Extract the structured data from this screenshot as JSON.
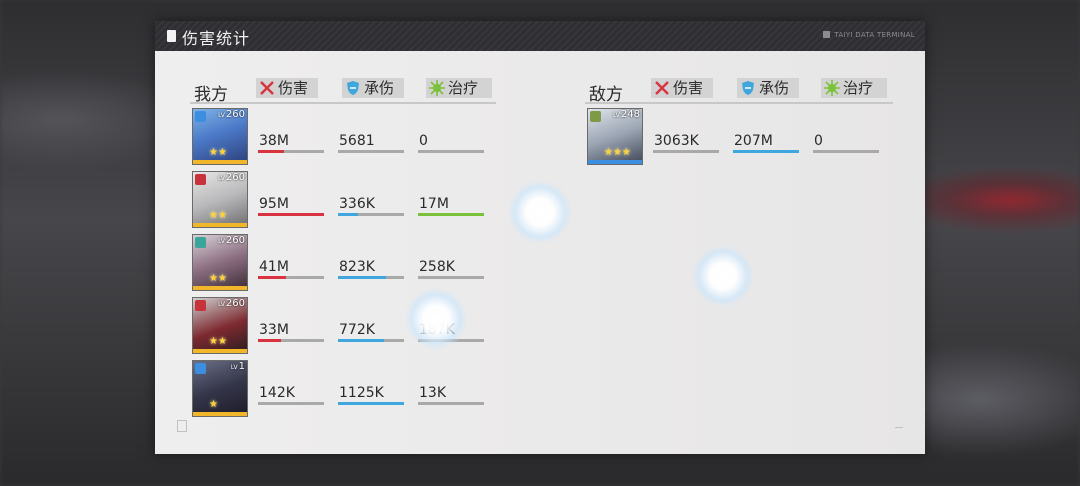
{
  "window": {
    "title": "伤害统计",
    "terminal": "TAIYI DATA TERMINAL"
  },
  "headers": {
    "damage": "伤害",
    "taken": "承伤",
    "heal": "治疗"
  },
  "colors": {
    "damage_bar": "#d7343f",
    "taken_bar": "#3fa7de",
    "heal_bar": "#7cc13a",
    "track": "#a9a9a9",
    "rarity_gold": "#f1b62a",
    "rarity_blue": "#3c8fe0"
  },
  "ally": {
    "title": "我方",
    "rows": [
      {
        "level": "260",
        "lv": "LV",
        "stars": "★★",
        "damage": "38M",
        "taken": "5681",
        "heal": "0",
        "damage_fill": 0.4,
        "taken_fill": 0.0,
        "heal_fill": 0.0,
        "badge": "gear-badge",
        "rarity": "gold"
      },
      {
        "level": "260",
        "lv": "LV",
        "stars": "★★",
        "damage": "95M",
        "taken": "336K",
        "heal": "17M",
        "damage_fill": 1.0,
        "taken_fill": 0.3,
        "heal_fill": 1.0,
        "badge": "arch-badge",
        "rarity": "gold"
      },
      {
        "level": "260",
        "lv": "LV",
        "stars": "★★",
        "damage": "41M",
        "taken": "823K",
        "heal": "258K",
        "damage_fill": 0.43,
        "taken_fill": 0.73,
        "heal_fill": 0.0,
        "badge": "flower-badge",
        "rarity": "gold"
      },
      {
        "level": "260",
        "lv": "LV",
        "stars": "★★",
        "damage": "33M",
        "taken": "772K",
        "heal": "187K",
        "damage_fill": 0.35,
        "taken_fill": 0.69,
        "heal_fill": 0.0,
        "badge": "arch-badge",
        "rarity": "gold"
      },
      {
        "level": "1",
        "lv": "LV",
        "stars": "★",
        "damage": "142K",
        "taken": "1125K",
        "heal": "13K",
        "damage_fill": 0.0,
        "taken_fill": 1.0,
        "heal_fill": 0.0,
        "badge": "gear-badge",
        "rarity": "gold"
      }
    ]
  },
  "enemy": {
    "title": "敌方",
    "rows": [
      {
        "level": "248",
        "lv": "LV",
        "stars": "★★★",
        "damage": "3063K",
        "taken": "207M",
        "heal": "0",
        "damage_fill": 0.0,
        "taken_fill": 1.0,
        "heal_fill": 0.0,
        "badge": "shield-badge",
        "rarity": "blue"
      }
    ]
  }
}
